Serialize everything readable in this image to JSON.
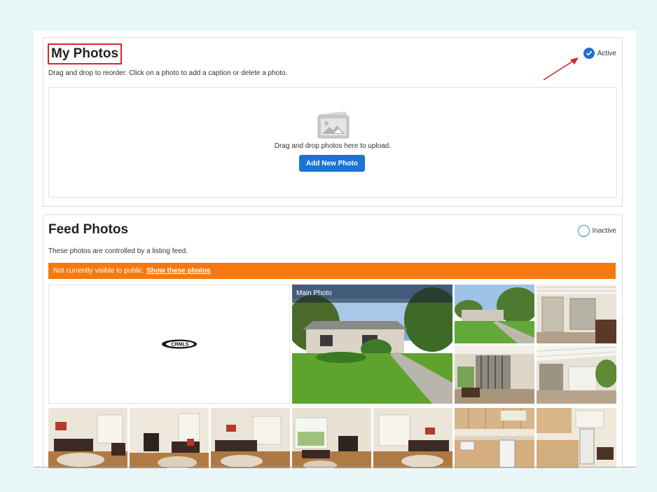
{
  "my_photos": {
    "title": "My Photos",
    "instructions": "Drag and drop to reorder. Click on a photo to add a caption or delete a photo.",
    "status": "Active",
    "dropzone_text": "Drag and drop photos here to upload.",
    "add_button": "Add New Photo"
  },
  "feed_photos": {
    "title": "Feed Photos",
    "description": "These photos are controlled by a listing feed.",
    "status": "Inactive",
    "banner_text": "Not currently visible to public.",
    "banner_link": "Show these photos",
    "main_photo_label": "Main Photo",
    "logo_text": "CRMLS"
  },
  "colors": {
    "banner": "#f7790d",
    "button": "#1a73d6",
    "highlight_border": "#d7262e",
    "annotation_arrow": "#d7262e"
  }
}
